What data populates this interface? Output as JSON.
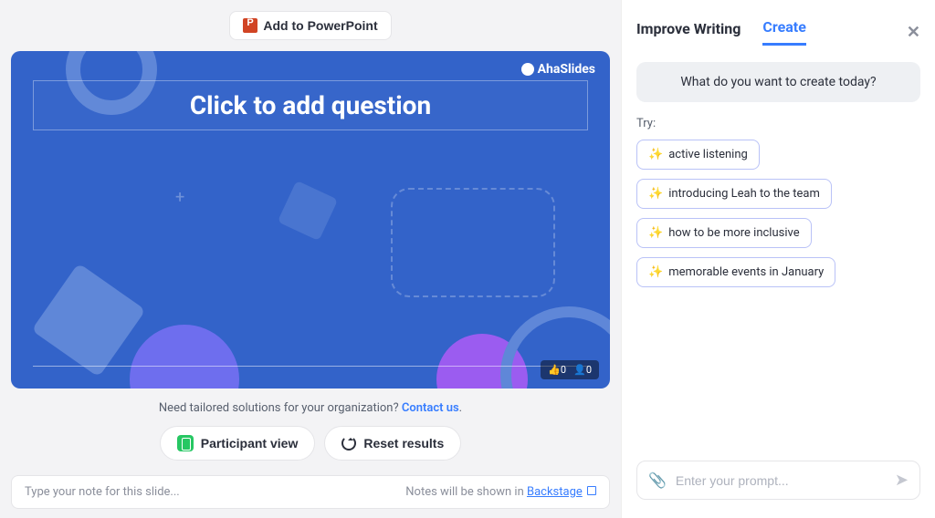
{
  "toolbar": {
    "add_powerpoint": "Add to PowerPoint"
  },
  "slide": {
    "brand": "AhaSlides",
    "question_placeholder": "Click to add question",
    "thumbs": "0",
    "people": "0"
  },
  "help": {
    "prefix": "Need tailored solutions for your organization? ",
    "link": "Contact us",
    "suffix": "."
  },
  "actions": {
    "participant": "Participant view",
    "reset": "Reset results"
  },
  "notes": {
    "placeholder": "Type your note for this slide...",
    "shown_prefix": "Notes will be shown in ",
    "backstage": "Backstage"
  },
  "panel": {
    "tab_improve": "Improve Writing",
    "tab_create": "Create",
    "hero": "What do you want to create today?",
    "try_label": "Try:",
    "chips": [
      {
        "label": "active listening"
      },
      {
        "label": "introducing Leah to the team"
      },
      {
        "label": "how to be more inclusive"
      },
      {
        "label": "memorable events in January"
      }
    ],
    "input_placeholder": "Enter your prompt..."
  }
}
